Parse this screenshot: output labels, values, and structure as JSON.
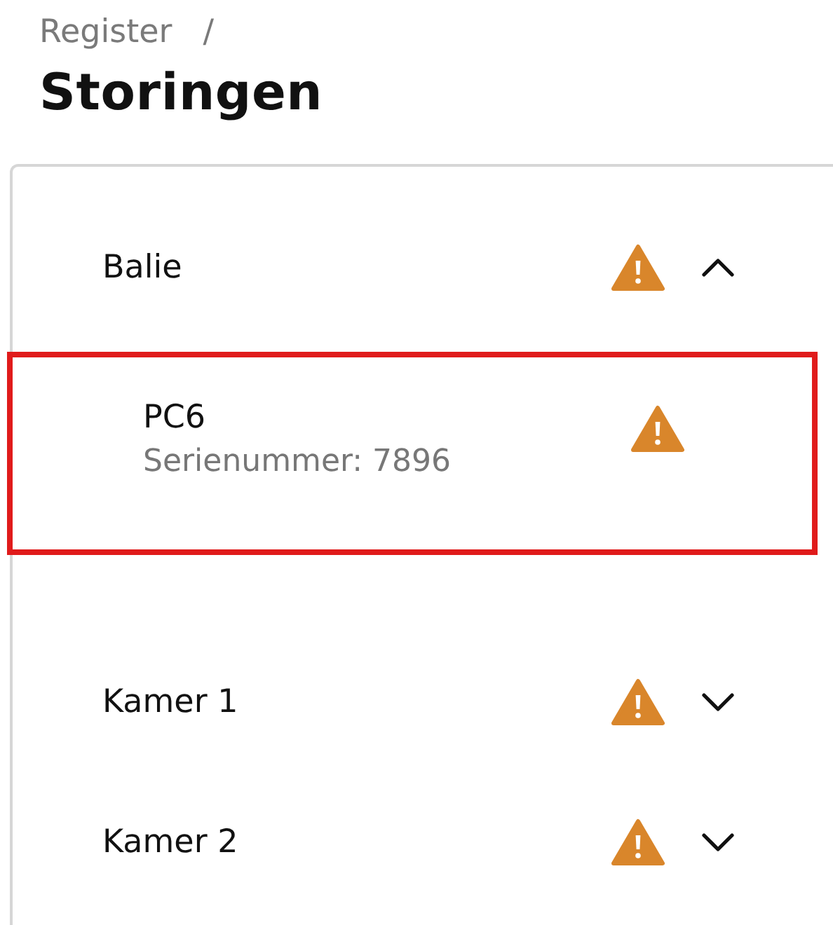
{
  "breadcrumb": {
    "label": "Register",
    "separator": "/"
  },
  "title": "Storingen",
  "groups": [
    {
      "name": "Balie",
      "warning": true,
      "expanded": true,
      "children": [
        {
          "name": "PC6",
          "detail": "Serienummer: 7896",
          "warning": true,
          "selected": true
        }
      ]
    },
    {
      "name": "Kamer 1",
      "warning": true,
      "expanded": false
    },
    {
      "name": "Kamer 2",
      "warning": true,
      "expanded": false
    }
  ]
}
